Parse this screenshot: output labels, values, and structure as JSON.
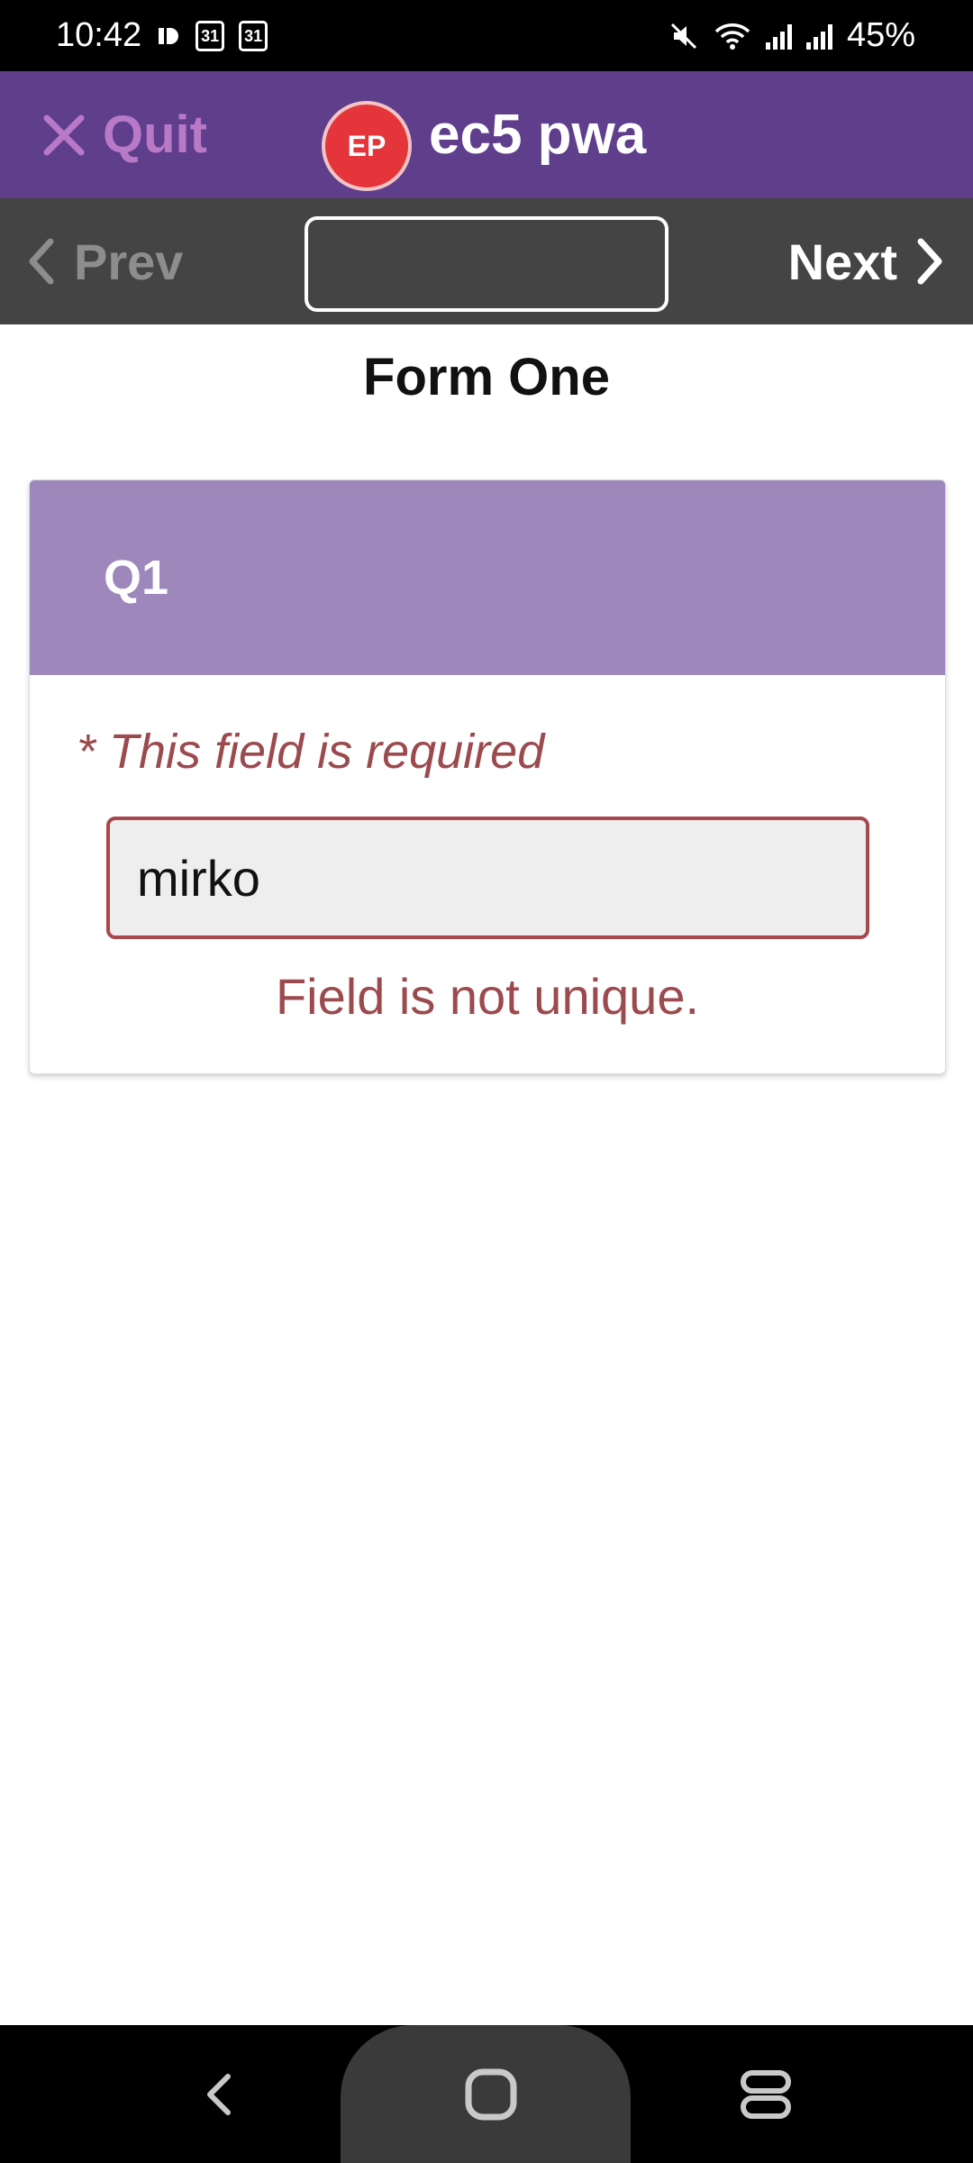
{
  "status_bar": {
    "time": "10:42",
    "calendar_day_1": "31",
    "calendar_day_2": "31",
    "battery": "45%",
    "icons": [
      "media-icon",
      "calendar-icon",
      "calendar-icon",
      "mute-icon",
      "wifi-icon",
      "signal-icon",
      "signal-r-icon"
    ]
  },
  "header": {
    "quit_label": "Quit",
    "logo_text": "EP",
    "app_title": "ec5 pwa",
    "colors": {
      "header_bg": "#5f3e8c",
      "quit": "#b879c7",
      "logo_bg": "#e4353b"
    }
  },
  "nav": {
    "prev_label": "Prev",
    "next_label": "Next",
    "jump_value": ""
  },
  "form": {
    "title": "Form One",
    "question": {
      "label": "Q1",
      "required_text": "* This field is required",
      "answer_value": "mirko",
      "error_text": "Field is not unique.",
      "colors": {
        "header_bg": "#9d87bb",
        "error": "#9b4a4e"
      }
    }
  },
  "system_nav": {
    "buttons": [
      "back-icon",
      "home-icon",
      "recents-icon"
    ]
  }
}
